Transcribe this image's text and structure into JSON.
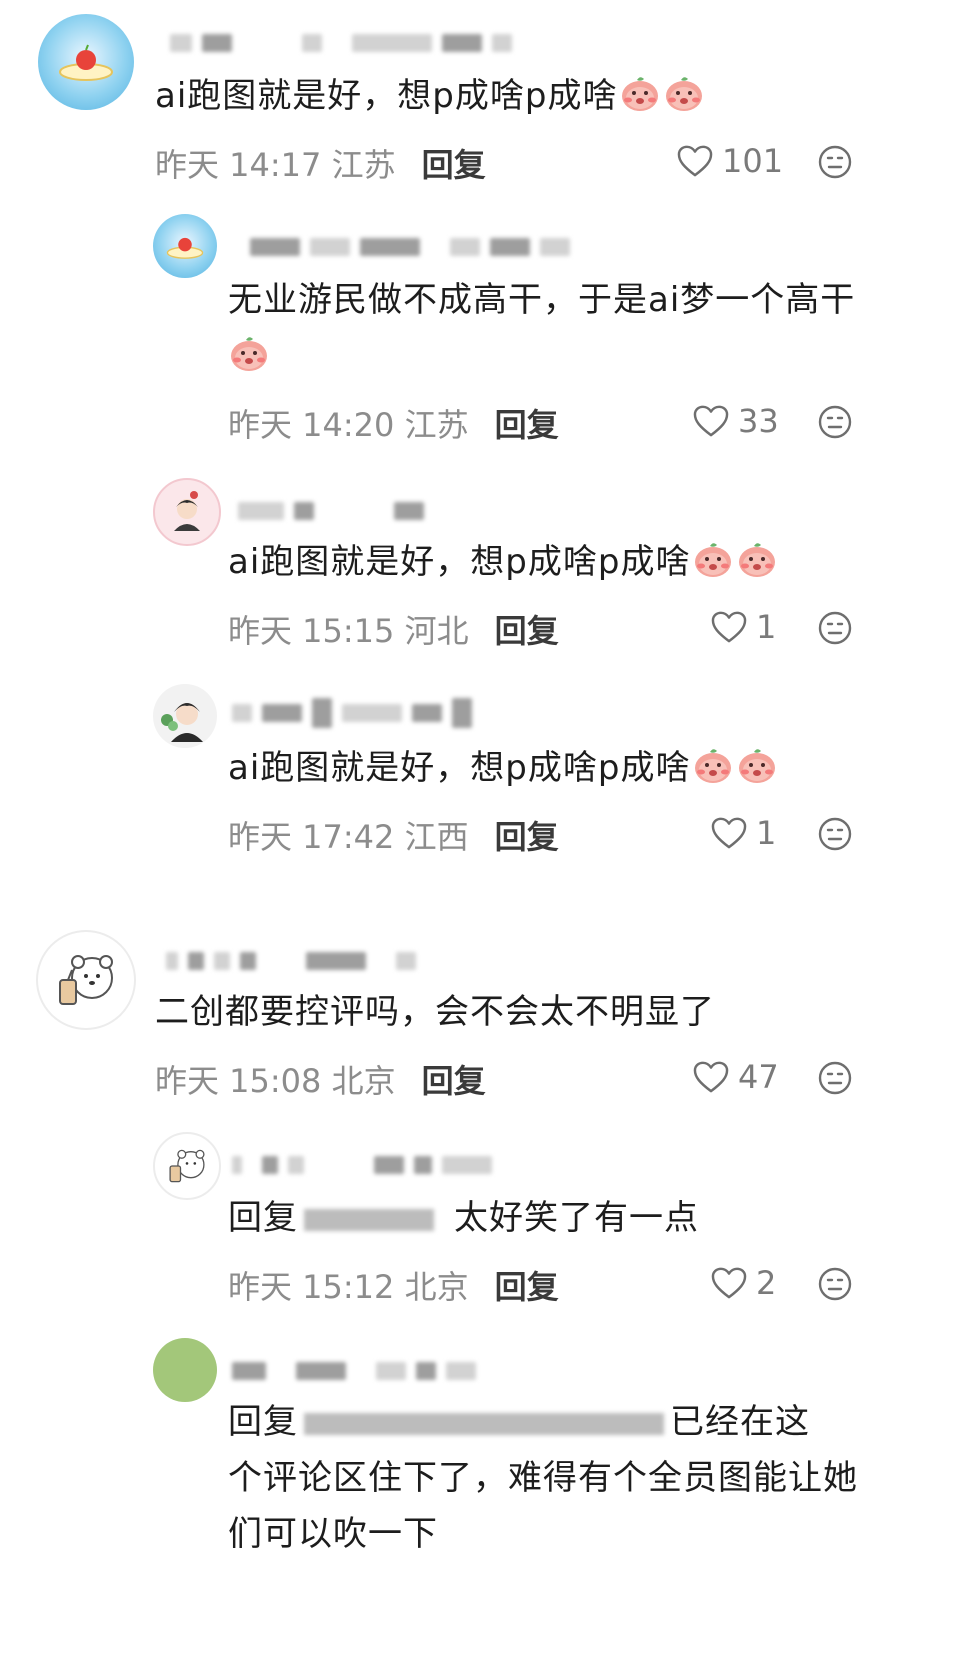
{
  "comments": [
    {
      "id": "c1",
      "text": "ai跑图就是好，想p成啥p成啥",
      "time": "昨天 14:17 江苏",
      "reply_label": "回复",
      "likes": "101",
      "avatar": "apple-plate-avatar"
    },
    {
      "id": "c2",
      "text": "无业游民做不成高干，于是ai梦一个高干",
      "time": "昨天 14:20 江苏",
      "reply_label": "回复",
      "likes": "33",
      "avatar": "apple-plate-avatar"
    },
    {
      "id": "c3",
      "text": "ai跑图就是好，想p成啥p成啥",
      "time": "昨天 15:15 河北",
      "reply_label": "回复",
      "likes": "1",
      "avatar": "anime-boy-avatar"
    },
    {
      "id": "c4",
      "text": "ai跑图就是好，想p成啥p成啥",
      "time": "昨天 17:42 江西",
      "reply_label": "回复",
      "likes": "1",
      "avatar": "anime-boy-avatar"
    },
    {
      "id": "c5",
      "text": "二创都要控评吗，会不会太不明显了",
      "time": "昨天 15:08 北京",
      "reply_label": "回复",
      "likes": "47",
      "avatar": "bear-boba-avatar"
    },
    {
      "id": "c6",
      "prefix": "回复",
      "text": "太好笑了有一点",
      "time": "昨天 15:12 北京",
      "reply_label": "回复",
      "likes": "2",
      "avatar": "bear-boba-avatar"
    },
    {
      "id": "c7",
      "prefix": "回复",
      "text_line1_tail": "已经在这",
      "text_line2": "个评论区住下了，难得有个全员图能让她",
      "text_line3": "们可以吹一下",
      "avatar": "green-circle-avatar"
    }
  ],
  "icons": {
    "like": "heart-outline-icon",
    "reaction": "neutral-face-icon",
    "emoji": "peach-mouth-emoji"
  },
  "colors": {
    "text": "#1d1d1d",
    "meta": "#8c8c8c",
    "reply": "#3a3a3a",
    "avatar_green": "#a3c77a"
  }
}
